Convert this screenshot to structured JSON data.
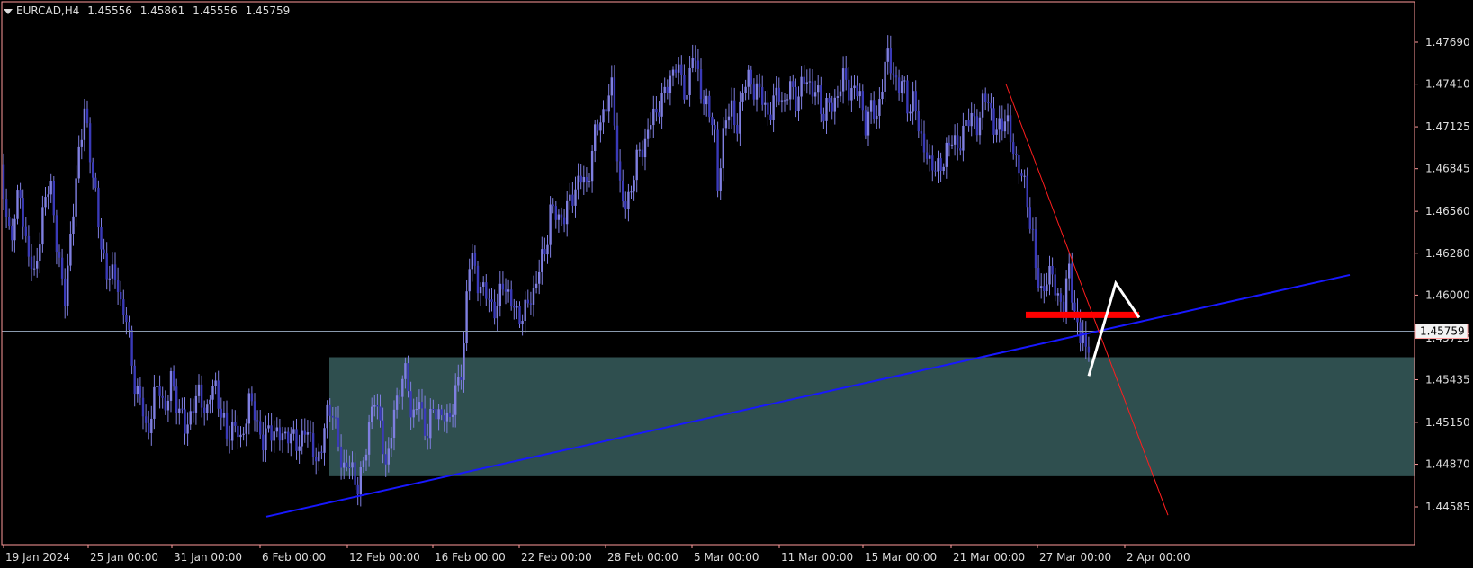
{
  "header": {
    "symbol": "EURCAD,H4",
    "open": "1.45556",
    "high": "1.45861",
    "low": "1.45556",
    "close": "1.45759"
  },
  "price_tag": "1.45759",
  "colors": {
    "background": "#000000",
    "frame": "#ff9a9a",
    "axis_text": "#dcdcdc",
    "candle": "#3a3ab8",
    "wick": "#7f7fe0",
    "zone": "#2f4f4f",
    "trendline_support": "#1818ff",
    "trendline_resistance": "#ff1e1e",
    "level_marker": "#ff0000",
    "projection": "#ffffff",
    "price_line": "#8a9aae"
  },
  "chart_data": {
    "type": "candlestick",
    "symbol": "EURCAD",
    "timeframe": "H4",
    "y_ticks": [
      "1.47690",
      "1.47410",
      "1.47125",
      "1.46845",
      "1.46560",
      "1.46280",
      "1.46000",
      "1.45715",
      "1.45435",
      "1.45150",
      "1.44870",
      "1.44585"
    ],
    "x_ticks": [
      "19 Jan 2024",
      "25 Jan 00:00",
      "31 Jan 00:00",
      "6 Feb 00:00",
      "12 Feb 00:00",
      "16 Feb 00:00",
      "22 Feb 00:00",
      "28 Feb 00:00",
      "5 Mar 00:00",
      "11 Mar 00:00",
      "15 Mar 00:00",
      "21 Mar 00:00",
      "27 Mar 00:00",
      "2 Apr 00:00"
    ],
    "ylim": [
      1.4452,
      1.4795
    ],
    "current_price": 1.45759,
    "close_path": [
      [
        0,
        1.4687
      ],
      [
        5,
        1.466
      ],
      [
        12,
        1.4638
      ],
      [
        22,
        1.467
      ],
      [
        30,
        1.463
      ],
      [
        38,
        1.4612
      ],
      [
        46,
        1.4648
      ],
      [
        56,
        1.468
      ],
      [
        64,
        1.4625
      ],
      [
        72,
        1.46
      ],
      [
        80,
        1.4645
      ],
      [
        88,
        1.47
      ],
      [
        94,
        1.4722
      ],
      [
        98,
        1.4703
      ],
      [
        106,
        1.467
      ],
      [
        112,
        1.463
      ],
      [
        120,
        1.4615
      ],
      [
        130,
        1.461
      ],
      [
        134,
        1.4595
      ],
      [
        140,
        1.4585
      ],
      [
        150,
        1.454
      ],
      [
        158,
        1.4525
      ],
      [
        164,
        1.4505
      ],
      [
        170,
        1.453
      ],
      [
        178,
        1.454
      ],
      [
        184,
        1.452
      ],
      [
        190,
        1.4545
      ],
      [
        198,
        1.4525
      ],
      [
        206,
        1.451
      ],
      [
        214,
        1.4525
      ],
      [
        222,
        1.4535
      ],
      [
        230,
        1.452
      ],
      [
        238,
        1.4545
      ],
      [
        244,
        1.4525
      ],
      [
        252,
        1.4505
      ],
      [
        260,
        1.4515
      ],
      [
        268,
        1.45
      ],
      [
        276,
        1.453
      ],
      [
        284,
        1.452
      ],
      [
        292,
        1.45
      ],
      [
        300,
        1.4512
      ],
      [
        310,
        1.4505
      ],
      [
        320,
        1.4508
      ],
      [
        330,
        1.45
      ],
      [
        340,
        1.451
      ],
      [
        350,
        1.4495
      ],
      [
        356,
        1.4485
      ],
      [
        362,
        1.4525
      ],
      [
        370,
        1.452
      ],
      [
        376,
        1.45
      ],
      [
        384,
        1.448
      ],
      [
        390,
        1.449
      ],
      [
        396,
        1.447
      ],
      [
        404,
        1.4485
      ],
      [
        410,
        1.4515
      ],
      [
        416,
        1.453
      ],
      [
        424,
        1.451
      ],
      [
        430,
        1.448
      ],
      [
        438,
        1.4525
      ],
      [
        446,
        1.454
      ],
      [
        452,
        1.455
      ],
      [
        458,
        1.4515
      ],
      [
        466,
        1.453
      ],
      [
        474,
        1.4505
      ],
      [
        482,
        1.4525
      ],
      [
        490,
        1.452
      ],
      [
        498,
        1.4515
      ],
      [
        506,
        1.4535
      ],
      [
        512,
        1.4545
      ],
      [
        516,
        1.457
      ],
      [
        520,
        1.462
      ],
      [
        524,
        1.4625
      ],
      [
        530,
        1.461
      ],
      [
        536,
        1.4605
      ],
      [
        544,
        1.4595
      ],
      [
        552,
        1.459
      ],
      [
        560,
        1.461
      ],
      [
        568,
        1.4595
      ],
      [
        576,
        1.4585
      ],
      [
        584,
        1.459
      ],
      [
        592,
        1.46
      ],
      [
        600,
        1.462
      ],
      [
        606,
        1.4628
      ],
      [
        612,
        1.466
      ],
      [
        620,
        1.465
      ],
      [
        628,
        1.4655
      ],
      [
        636,
        1.4665
      ],
      [
        644,
        1.468
      ],
      [
        652,
        1.4672
      ],
      [
        660,
        1.4705
      ],
      [
        668,
        1.4718
      ],
      [
        674,
        1.4728
      ],
      [
        680,
        1.4738
      ],
      [
        684,
        1.471
      ],
      [
        690,
        1.4665
      ],
      [
        696,
        1.4658
      ],
      [
        702,
        1.4675
      ],
      [
        710,
        1.4695
      ],
      [
        716,
        1.47
      ],
      [
        722,
        1.4715
      ],
      [
        728,
        1.472
      ],
      [
        734,
        1.473
      ],
      [
        740,
        1.4735
      ],
      [
        746,
        1.4748
      ],
      [
        752,
        1.4755
      ],
      [
        758,
        1.474
      ],
      [
        764,
        1.4735
      ],
      [
        770,
        1.4762
      ],
      [
        776,
        1.4748
      ],
      [
        782,
        1.4728
      ],
      [
        788,
        1.4722
      ],
      [
        794,
        1.4715
      ],
      [
        797,
        1.467
      ],
      [
        800,
        1.468
      ],
      [
        806,
        1.472
      ],
      [
        812,
        1.4728
      ],
      [
        818,
        1.4705
      ],
      [
        824,
        1.4735
      ],
      [
        830,
        1.4745
      ],
      [
        836,
        1.4738
      ],
      [
        842,
        1.474
      ],
      [
        848,
        1.4728
      ],
      [
        854,
        1.472
      ],
      [
        860,
        1.473
      ],
      [
        866,
        1.4735
      ],
      [
        872,
        1.4728
      ],
      [
        878,
        1.474
      ],
      [
        884,
        1.473
      ],
      [
        890,
        1.4738
      ],
      [
        896,
        1.4745
      ],
      [
        902,
        1.4738
      ],
      [
        908,
        1.4735
      ],
      [
        914,
        1.472
      ],
      [
        920,
        1.473
      ],
      [
        926,
        1.4722
      ],
      [
        932,
        1.474
      ],
      [
        938,
        1.4745
      ],
      [
        944,
        1.4735
      ],
      [
        950,
        1.474
      ],
      [
        956,
        1.473
      ],
      [
        962,
        1.4715
      ],
      [
        968,
        1.4725
      ],
      [
        974,
        1.4718
      ],
      [
        980,
        1.474
      ],
      [
        986,
        1.476
      ],
      [
        992,
        1.4752
      ],
      [
        998,
        1.4735
      ],
      [
        1004,
        1.4745
      ],
      [
        1010,
        1.4722
      ],
      [
        1016,
        1.473
      ],
      [
        1022,
        1.471
      ],
      [
        1028,
        1.4695
      ],
      [
        1034,
        1.4685
      ],
      [
        1040,
        1.469
      ],
      [
        1046,
        1.468
      ],
      [
        1052,
        1.47
      ],
      [
        1058,
        1.4705
      ],
      [
        1064,
        1.4695
      ],
      [
        1070,
        1.4712
      ],
      [
        1076,
        1.4715
      ],
      [
        1082,
        1.472
      ],
      [
        1088,
        1.4712
      ],
      [
        1094,
        1.4735
      ],
      [
        1100,
        1.4728
      ],
      [
        1106,
        1.4705
      ],
      [
        1112,
        1.4715
      ],
      [
        1118,
        1.472
      ],
      [
        1124,
        1.47
      ],
      [
        1130,
        1.469
      ],
      [
        1136,
        1.468
      ],
      [
        1142,
        1.466
      ],
      [
        1148,
        1.464
      ],
      [
        1152,
        1.461
      ],
      [
        1158,
        1.46
      ],
      [
        1164,
        1.4615
      ],
      [
        1170,
        1.461
      ],
      [
        1176,
        1.46
      ],
      [
        1182,
        1.459
      ],
      [
        1188,
        1.462
      ],
      [
        1192,
        1.46
      ],
      [
        1196,
        1.458
      ],
      [
        1200,
        1.457
      ],
      [
        1204,
        1.4575
      ],
      [
        1208,
        1.456
      ],
      [
        1212,
        1.45759
      ]
    ],
    "annotations": {
      "demand_zone": {
        "from_index": 366,
        "price_top": 1.45585,
        "price_bottom": 1.4479
      },
      "support_trendline": {
        "from": [
          296,
          1.4452
        ],
        "to": [
          1500,
          1.46135
        ]
      },
      "resistance_trendline": {
        "from": [
          1118,
          1.4741
        ],
        "to": [
          1298,
          1.4453
        ]
      },
      "level_marker": {
        "from_index": 1140,
        "to_index": 1266,
        "price": 1.45868
      },
      "projection_path": [
        [
          1210,
          1.4546
        ],
        [
          1240,
          1.4608
        ],
        [
          1266,
          1.4585
        ]
      ]
    }
  }
}
